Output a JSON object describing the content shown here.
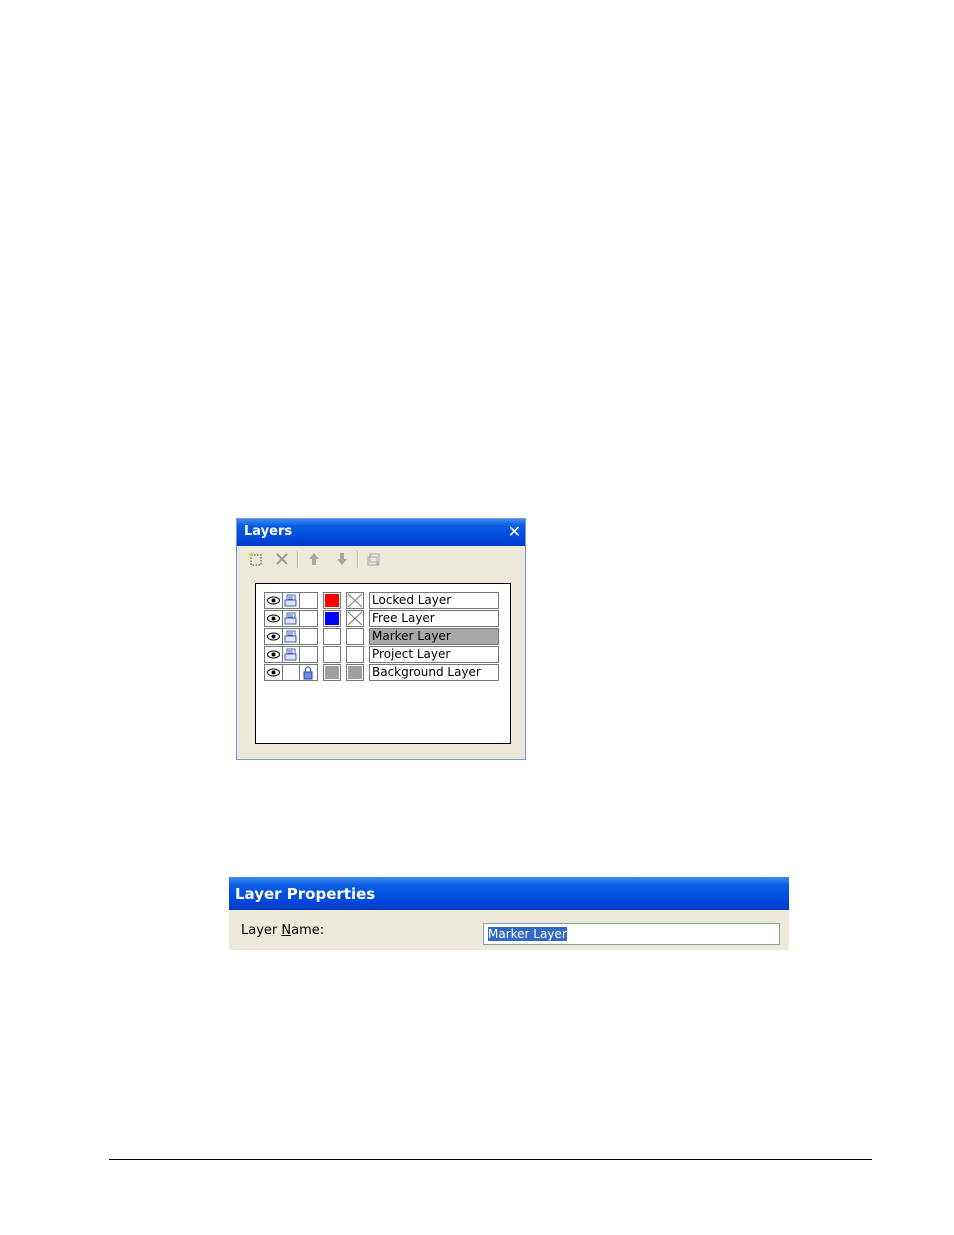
{
  "layers_panel": {
    "title": "Layers",
    "close_glyph": "✕",
    "toolbar": {
      "buttons": [
        "new-layer-icon",
        "delete-layer-icon",
        "move-up-icon",
        "move-down-icon",
        "layer-properties-icon"
      ]
    },
    "layers": [
      {
        "name": "Locked Layer",
        "visible": true,
        "printable": true,
        "locked": false,
        "color": "#ff0000",
        "hatch": "x",
        "selected": false
      },
      {
        "name": "Free Layer",
        "visible": true,
        "printable": true,
        "locked": false,
        "color": "#0000ff",
        "hatch": "x",
        "selected": false
      },
      {
        "name": "Marker Layer",
        "visible": true,
        "printable": true,
        "locked": false,
        "color": "#ffffff",
        "hatch": "none",
        "selected": true
      },
      {
        "name": "Project Layer",
        "visible": true,
        "printable": true,
        "locked": false,
        "color": "#ffffff",
        "hatch": "none",
        "selected": false
      },
      {
        "name": "Background Layer",
        "visible": true,
        "printable": false,
        "locked": true,
        "color": "#a0a0a0",
        "hatch": "gray",
        "selected": false
      }
    ]
  },
  "layer_properties": {
    "title": "Layer Properties",
    "name_label": "Layer Name:",
    "name_value": "Marker Layer"
  },
  "colors": {
    "title_bar": "#0049dd",
    "panel_bg": "#ece9d8",
    "selection": "#a9a9a9",
    "text_selection": "#316ac5"
  }
}
